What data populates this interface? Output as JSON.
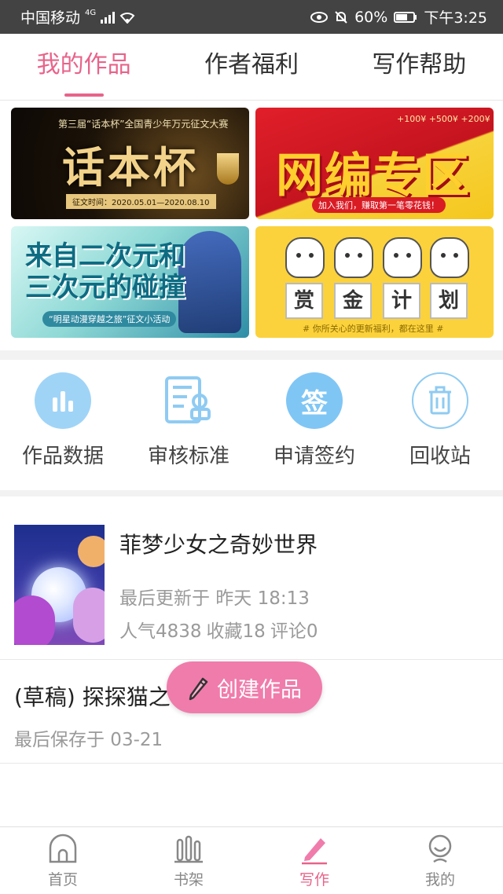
{
  "status_bar": {
    "carrier": "中国移动",
    "network": "4G",
    "battery": "60%",
    "time": "下午3:25"
  },
  "tabs": [
    {
      "label": "我的作品",
      "active": true
    },
    {
      "label": "作者福利",
      "active": false
    },
    {
      "label": "写作帮助",
      "active": false
    }
  ],
  "banners": {
    "b1": {
      "subtitle": "第三届“话本杯”全国青少年万元征文大赛",
      "title": "话本杯",
      "date": "征文时间：2020.05.01—2020.08.10"
    },
    "b2": {
      "coins": "+100¥  +500¥  +200¥",
      "title": "网编专区",
      "subtitle": "加入我们，赚取第一笔零花钱！"
    },
    "b3": {
      "title": "来自二次元和三次元的碰撞",
      "subtitle": "“明星动漫穿越之旅”征文小活动"
    },
    "b4": {
      "chars": [
        "赏",
        "金",
        "计",
        "划"
      ],
      "subtitle": "# 你所关心的更新福利，都在这里 #"
    }
  },
  "quick_actions": [
    {
      "label": "作品数据",
      "icon": "bar-chart-icon"
    },
    {
      "label": "审核标准",
      "icon": "review-doc-icon"
    },
    {
      "label": "申请签约",
      "icon": "sign-icon"
    },
    {
      "label": "回收站",
      "icon": "trash-icon"
    }
  ],
  "sign_glyph": "签",
  "works": [
    {
      "title": "菲梦少女之奇妙世界",
      "updated": "最后更新于 昨天 18:13",
      "popularity": "人气4838",
      "favorites": "收藏18",
      "comments": "评论0"
    },
    {
      "title": "(草稿) 探探猫之",
      "saved": "最后保存于 03-21"
    }
  ],
  "create_button": {
    "label": "创建作品"
  },
  "bottom_nav": [
    {
      "label": "首页",
      "icon": "home-icon",
      "active": false
    },
    {
      "label": "书架",
      "icon": "bookshelf-icon",
      "active": false
    },
    {
      "label": "写作",
      "icon": "pencil-icon",
      "active": true
    },
    {
      "label": "我的",
      "icon": "profile-icon",
      "active": false
    }
  ],
  "colors": {
    "accent": "#e8638a",
    "button": "#f07cab",
    "icon_blue": "#9fd4f7"
  }
}
